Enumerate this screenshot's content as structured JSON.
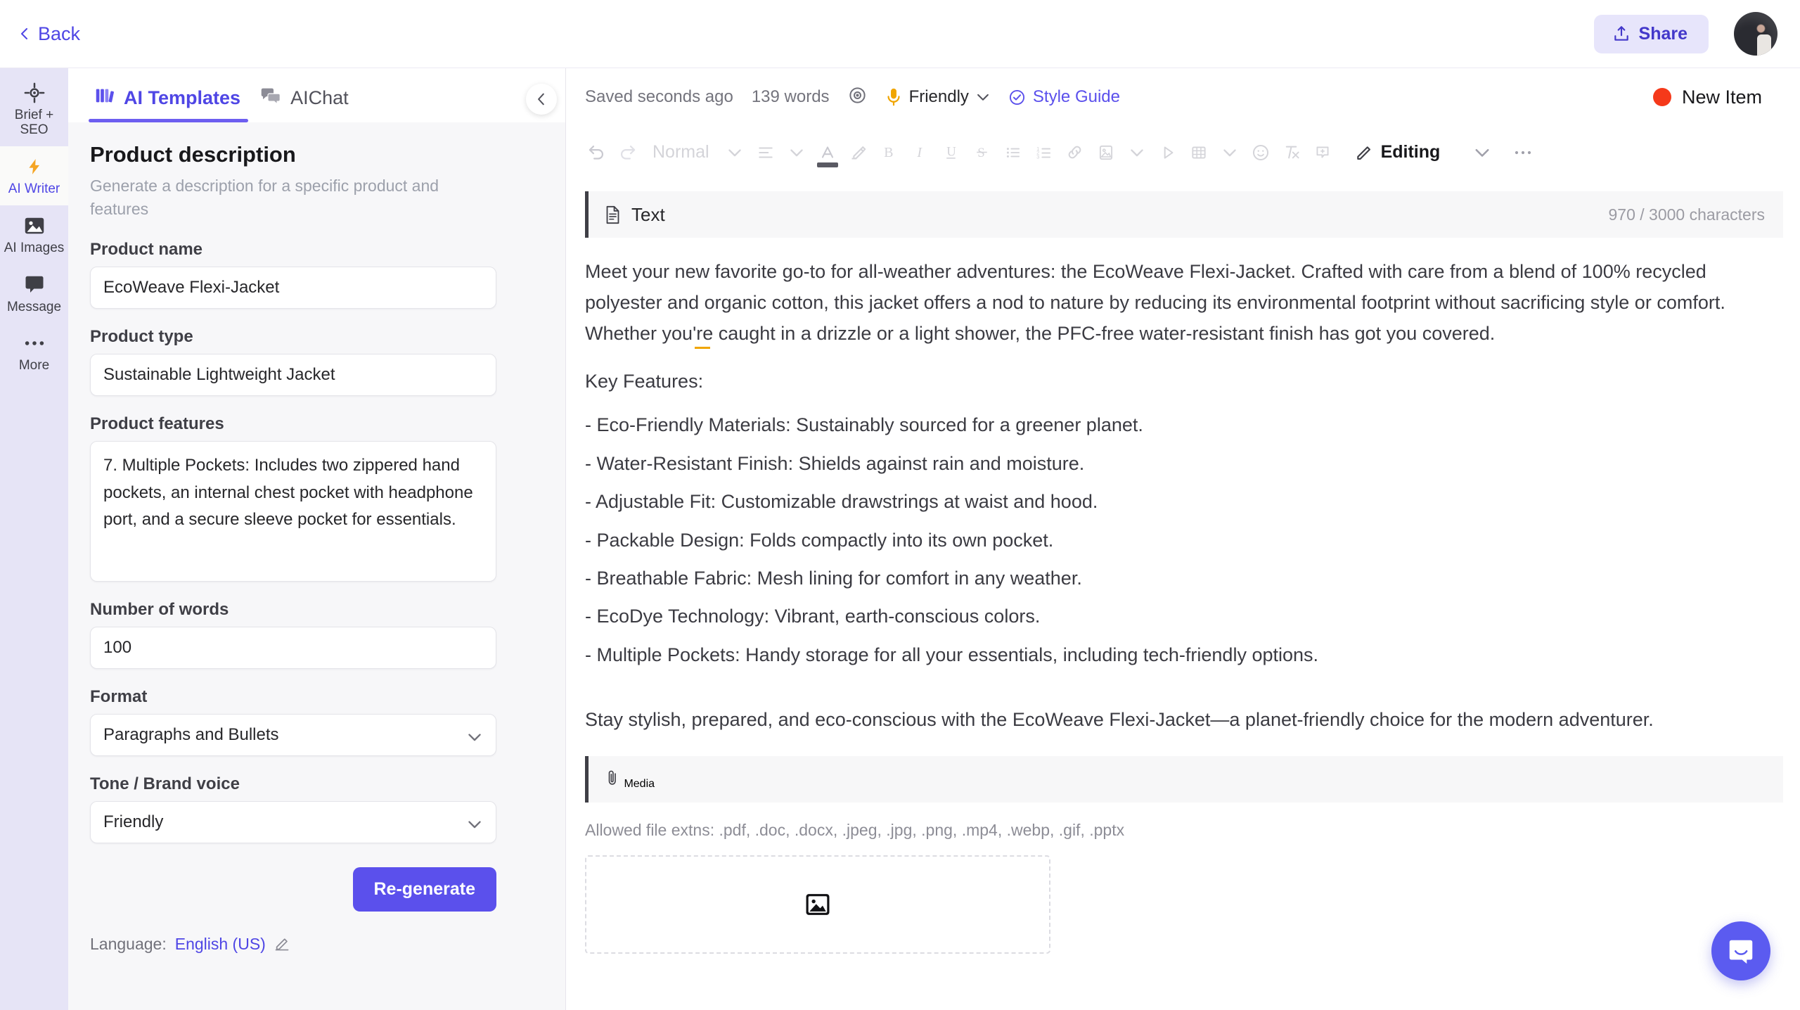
{
  "topbar": {
    "back_label": "Back",
    "share_label": "Share"
  },
  "rail": {
    "items": [
      {
        "label": "Brief + SEO",
        "icon": "target-icon",
        "active": false
      },
      {
        "label": "AI Writer",
        "icon": "lightning-icon",
        "active": true
      },
      {
        "label": "AI Images",
        "icon": "image-icon",
        "active": false
      },
      {
        "label": "Message",
        "icon": "chat-bubble-icon",
        "active": false
      },
      {
        "label": "More",
        "icon": "ellipsis-icon",
        "active": false
      }
    ]
  },
  "panel": {
    "tabs": [
      {
        "label": "AI Templates",
        "icon": "templates-icon",
        "active": true
      },
      {
        "label": "AIChat",
        "icon": "chat-icon",
        "active": false
      }
    ],
    "template_title": "Product description",
    "template_subtitle": "Generate a description for a specific product and features",
    "fields": {
      "product_name": {
        "label": "Product name",
        "value": "EcoWeave Flexi-Jacket"
      },
      "product_type": {
        "label": "Product type",
        "value": "Sustainable Lightweight Jacket"
      },
      "product_features": {
        "label": "Product features",
        "value": "7. Multiple Pockets: Includes two zippered hand pockets, an internal chest pocket with headphone port, and a secure sleeve pocket for essentials."
      },
      "number_of_words": {
        "label": "Number of words",
        "value": "100"
      },
      "format": {
        "label": "Format",
        "value": "Paragraphs and Bullets"
      },
      "tone": {
        "label": "Tone / Brand voice",
        "value": "Friendly"
      }
    },
    "regenerate_label": "Re-generate",
    "language_prefix": "Language:",
    "language_value": "English (US)"
  },
  "editor": {
    "saved_status": "Saved seconds ago",
    "word_count": "139 words",
    "tone_label": "Friendly",
    "style_guide_label": "Style Guide",
    "new_item_label": "New Item",
    "toolbar": {
      "paragraph_style": "Normal",
      "editing_label": "Editing"
    },
    "text_section": {
      "title": "Text",
      "char_count": "970 / 3000 characters",
      "paragraph_1": "Meet your new favorite go-to for all-weather adventures: the EcoWeave Flexi-Jacket. Crafted with care from a blend of 100% recycled polyester and organic cotton, this jacket offers a nod to nature by reducing its environmental footprint without sacrificing style or comfort. Whether you're caught in a drizzle or a light shower, the PFC-free water-resistant finish has got you covered.",
      "key_features_heading": "Key Features:",
      "features": [
        "- Eco-Friendly Materials: Sustainably sourced for a greener planet.",
        "- Water-Resistant Finish: Shields against rain and moisture.",
        "- Adjustable Fit: Customizable drawstrings at waist and hood.",
        "- Packable Design: Folds compactly into its own pocket.",
        "- Breathable Fabric: Mesh lining for comfort in any weather.",
        "- EcoDye Technology: Vibrant, earth-conscious colors.",
        "- Multiple Pockets: Handy storage for all your essentials, including tech-friendly options."
      ],
      "closing_paragraph": "Stay stylish, prepared, and eco-conscious with the EcoWeave Flexi-Jacket—a planet-friendly choice for the modern adventurer."
    },
    "media_section": {
      "title": "Media",
      "allowed_text": "Allowed file extns: .pdf, .doc, .docx, .jpeg, .jpg, .png, .mp4, .webp, .gif, .pptx"
    }
  },
  "colors": {
    "accent": "#5b50ec",
    "rail_bg": "#e6e4f6",
    "panel_bg": "#f7f7f9",
    "new_item_dot": "#f5391a"
  }
}
